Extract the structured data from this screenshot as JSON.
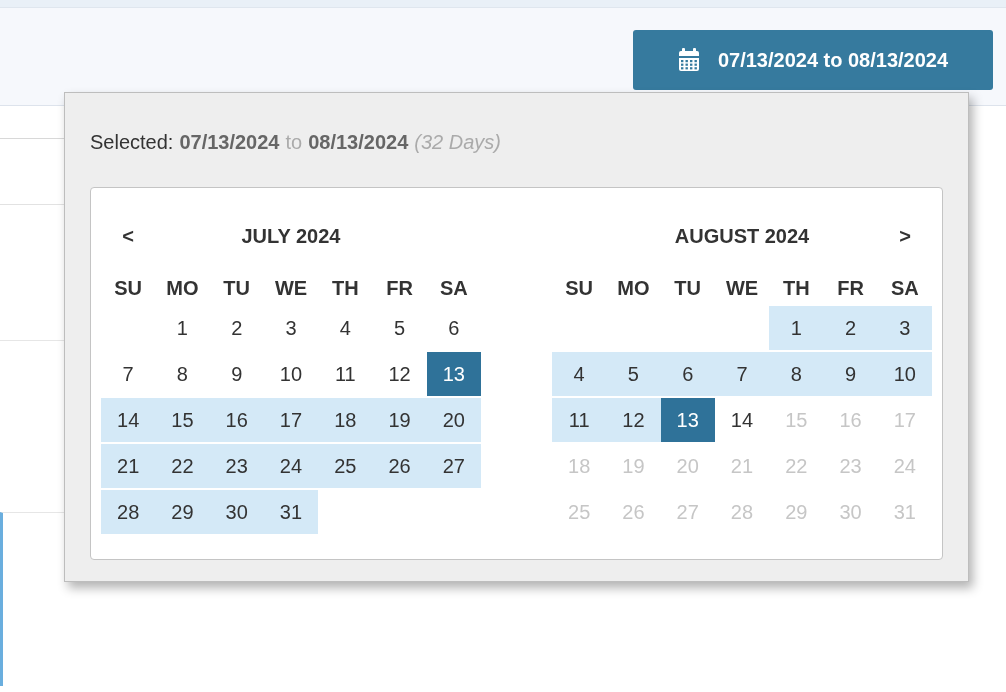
{
  "date_button": {
    "label": "07/13/2024 to 08/13/2024"
  },
  "picker": {
    "selected_label": "Selected:",
    "start": "07/13/2024",
    "connector": "to",
    "end": "08/13/2024",
    "duration": "(32 Days)",
    "months": [
      {
        "title": "JULY 2024",
        "prev_button": "<",
        "weekdays": [
          "SU",
          "MO",
          "TU",
          "WE",
          "TH",
          "FR",
          "SA"
        ],
        "weeks": [
          [
            {
              "kind": "blank"
            },
            {
              "kind": "day",
              "text": "1",
              "in_range": false,
              "selected": false,
              "muted": false
            },
            {
              "kind": "day",
              "text": "2",
              "in_range": false,
              "selected": false,
              "muted": false
            },
            {
              "kind": "day",
              "text": "3",
              "in_range": false,
              "selected": false,
              "muted": false
            },
            {
              "kind": "day",
              "text": "4",
              "in_range": false,
              "selected": false,
              "muted": false
            },
            {
              "kind": "day",
              "text": "5",
              "in_range": false,
              "selected": false,
              "muted": false
            },
            {
              "kind": "day",
              "text": "6",
              "in_range": false,
              "selected": false,
              "muted": false
            }
          ],
          [
            {
              "kind": "day",
              "text": "7",
              "in_range": false,
              "selected": false,
              "muted": false
            },
            {
              "kind": "day",
              "text": "8",
              "in_range": false,
              "selected": false,
              "muted": false
            },
            {
              "kind": "day",
              "text": "9",
              "in_range": false,
              "selected": false,
              "muted": false
            },
            {
              "kind": "day",
              "text": "10",
              "in_range": false,
              "selected": false,
              "muted": false
            },
            {
              "kind": "day",
              "text": "11",
              "in_range": false,
              "selected": false,
              "muted": false
            },
            {
              "kind": "day",
              "text": "12",
              "in_range": false,
              "selected": false,
              "muted": false
            },
            {
              "kind": "day",
              "text": "13",
              "selected": true
            }
          ],
          [
            {
              "kind": "day",
              "text": "14",
              "in_range": true,
              "selected": false,
              "muted": false
            },
            {
              "kind": "day",
              "text": "15",
              "in_range": true,
              "selected": false,
              "muted": false
            },
            {
              "kind": "day",
              "text": "16",
              "in_range": true,
              "selected": false,
              "muted": false
            },
            {
              "kind": "day",
              "text": "17",
              "in_range": true,
              "selected": false,
              "muted": false
            },
            {
              "kind": "day",
              "text": "18",
              "in_range": true,
              "selected": false,
              "muted": false
            },
            {
              "kind": "day",
              "text": "19",
              "in_range": true,
              "selected": false,
              "muted": false
            },
            {
              "kind": "day",
              "text": "20",
              "in_range": true,
              "selected": false,
              "muted": false
            }
          ],
          [
            {
              "kind": "day",
              "text": "21",
              "in_range": true,
              "selected": false,
              "muted": false
            },
            {
              "kind": "day",
              "text": "22",
              "in_range": true,
              "selected": false,
              "muted": false
            },
            {
              "kind": "day",
              "text": "23",
              "in_range": true,
              "selected": false,
              "muted": false
            },
            {
              "kind": "day",
              "text": "24",
              "in_range": true,
              "selected": false,
              "muted": false
            },
            {
              "kind": "day",
              "text": "25",
              "in_range": true,
              "selected": false,
              "muted": false
            },
            {
              "kind": "day",
              "text": "26",
              "in_range": true,
              "selected": false,
              "muted": false
            },
            {
              "kind": "day",
              "text": "27",
              "in_range": true,
              "selected": false,
              "muted": false
            }
          ],
          [
            {
              "kind": "day",
              "text": "28",
              "in_range": true,
              "selected": false,
              "muted": false
            },
            {
              "kind": "day",
              "text": "29",
              "in_range": true,
              "selected": false,
              "muted": false
            },
            {
              "kind": "day",
              "text": "30",
              "in_range": true,
              "selected": false,
              "muted": false
            },
            {
              "kind": "day",
              "text": "31",
              "in_range": true,
              "selected": false,
              "muted": false
            },
            {
              "kind": "blank"
            },
            {
              "kind": "blank"
            },
            {
              "kind": "blank"
            }
          ]
        ]
      },
      {
        "title": "AUGUST 2024",
        "next_button": ">",
        "weekdays": [
          "SU",
          "MO",
          "TU",
          "WE",
          "TH",
          "FR",
          "SA"
        ],
        "weeks": [
          [
            {
              "kind": "blank"
            },
            {
              "kind": "blank"
            },
            {
              "kind": "blank"
            },
            {
              "kind": "blank"
            },
            {
              "kind": "day",
              "text": "1",
              "in_range": true,
              "selected": false,
              "muted": false
            },
            {
              "kind": "day",
              "text": "2",
              "in_range": true,
              "selected": false,
              "muted": false
            },
            {
              "kind": "day",
              "text": "3",
              "in_range": true,
              "selected": false,
              "muted": false
            }
          ],
          [
            {
              "kind": "day",
              "text": "4",
              "in_range": true,
              "selected": false,
              "muted": false
            },
            {
              "kind": "day",
              "text": "5",
              "in_range": true,
              "selected": false,
              "muted": false
            },
            {
              "kind": "day",
              "text": "6",
              "in_range": true,
              "selected": false,
              "muted": false
            },
            {
              "kind": "day",
              "text": "7",
              "in_range": true,
              "selected": false,
              "muted": false
            },
            {
              "kind": "day",
              "text": "8",
              "in_range": true,
              "selected": false,
              "muted": false
            },
            {
              "kind": "day",
              "text": "9",
              "in_range": true,
              "selected": false,
              "muted": false
            },
            {
              "kind": "day",
              "text": "10",
              "in_range": true,
              "selected": false,
              "muted": false
            }
          ],
          [
            {
              "kind": "day",
              "text": "11",
              "in_range": true,
              "selected": false,
              "muted": false
            },
            {
              "kind": "day",
              "text": "12",
              "in_range": true,
              "selected": false,
              "muted": false
            },
            {
              "kind": "day",
              "text": "13",
              "selected": true
            },
            {
              "kind": "day",
              "text": "14",
              "in_range": false,
              "selected": false,
              "muted": false
            },
            {
              "kind": "day",
              "text": "15",
              "in_range": false,
              "selected": false,
              "muted": true
            },
            {
              "kind": "day",
              "text": "16",
              "in_range": false,
              "selected": false,
              "muted": true
            },
            {
              "kind": "day",
              "text": "17",
              "in_range": false,
              "selected": false,
              "muted": true
            }
          ],
          [
            {
              "kind": "day",
              "text": "18",
              "in_range": false,
              "selected": false,
              "muted": true
            },
            {
              "kind": "day",
              "text": "19",
              "in_range": false,
              "selected": false,
              "muted": true
            },
            {
              "kind": "day",
              "text": "20",
              "in_range": false,
              "selected": false,
              "muted": true
            },
            {
              "kind": "day",
              "text": "21",
              "in_range": false,
              "selected": false,
              "muted": true
            },
            {
              "kind": "day",
              "text": "22",
              "in_range": false,
              "selected": false,
              "muted": true
            },
            {
              "kind": "day",
              "text": "23",
              "in_range": false,
              "selected": false,
              "muted": true
            },
            {
              "kind": "day",
              "text": "24",
              "in_range": false,
              "selected": false,
              "muted": true
            }
          ],
          [
            {
              "kind": "day",
              "text": "25",
              "in_range": false,
              "selected": false,
              "muted": true
            },
            {
              "kind": "day",
              "text": "26",
              "in_range": false,
              "selected": false,
              "muted": true
            },
            {
              "kind": "day",
              "text": "27",
              "in_range": false,
              "selected": false,
              "muted": true
            },
            {
              "kind": "day",
              "text": "28",
              "in_range": false,
              "selected": false,
              "muted": true
            },
            {
              "kind": "day",
              "text": "29",
              "in_range": false,
              "selected": false,
              "muted": true
            },
            {
              "kind": "day",
              "text": "30",
              "in_range": false,
              "selected": false,
              "muted": true
            },
            {
              "kind": "day",
              "text": "31",
              "in_range": false,
              "selected": false,
              "muted": true
            }
          ]
        ]
      }
    ]
  }
}
